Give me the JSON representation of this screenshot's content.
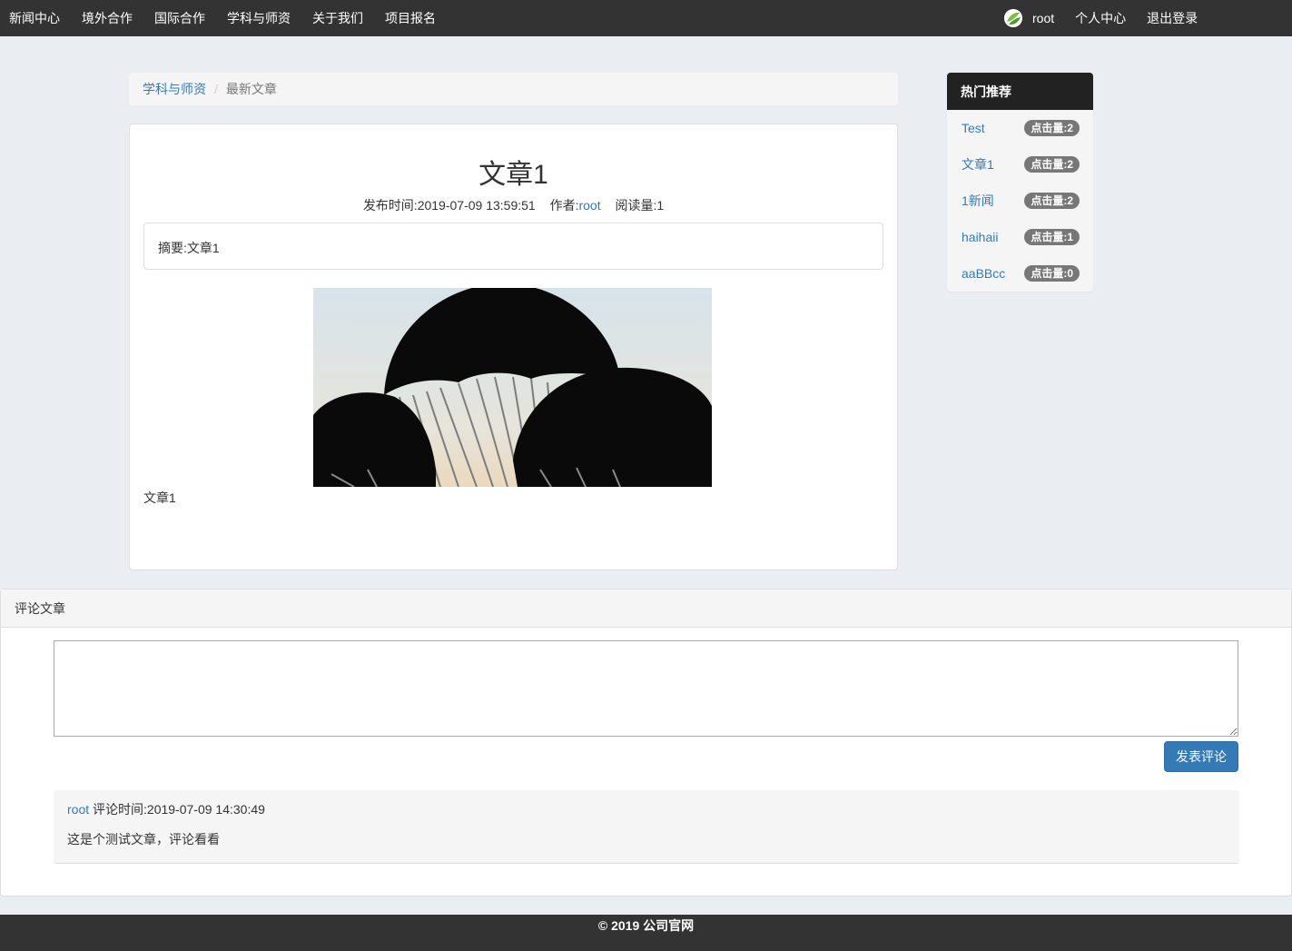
{
  "nav": {
    "items": [
      "新闻中心",
      "境外合作",
      "国际合作",
      "学科与师资",
      "关于我们",
      "项目报名"
    ],
    "username": "root",
    "profile": "个人中心",
    "logout": "退出登录"
  },
  "breadcrumb": {
    "parent": "学科与师资",
    "current": "最新文章"
  },
  "article": {
    "title": "文章1",
    "published_label": "发布时间:",
    "published": "2019-07-09 13:59:51",
    "author_label": "作者:",
    "author": "root",
    "reads_label": "阅读量:",
    "reads": "1",
    "summary_label": "摘要:",
    "summary": "文章1",
    "body": "文章1"
  },
  "hot": {
    "title": "热门推荐",
    "items": [
      {
        "title": "Test",
        "clicks": "点击量:2"
      },
      {
        "title": "文章1",
        "clicks": "点击量:2"
      },
      {
        "title": "1新闻",
        "clicks": "点击量:2"
      },
      {
        "title": "haihaii",
        "clicks": "点击量:1"
      },
      {
        "title": "aaBBcc",
        "clicks": "点击量:0"
      }
    ]
  },
  "comments": {
    "title": "评论文章",
    "textarea_value": "",
    "submit": "发表评论",
    "items": [
      {
        "user": "root",
        "time_label": " 评论时间:",
        "time": "2019-07-09 14:30:49",
        "text": "这是个测试文章，评论看看"
      }
    ]
  },
  "footer": "© 2019 公司官网",
  "colors": {
    "nav_bg": "#333333",
    "link": "#337ab7",
    "primary_button": "#337ab7",
    "badge": "#777777",
    "page_bg": "#eaeef2"
  }
}
